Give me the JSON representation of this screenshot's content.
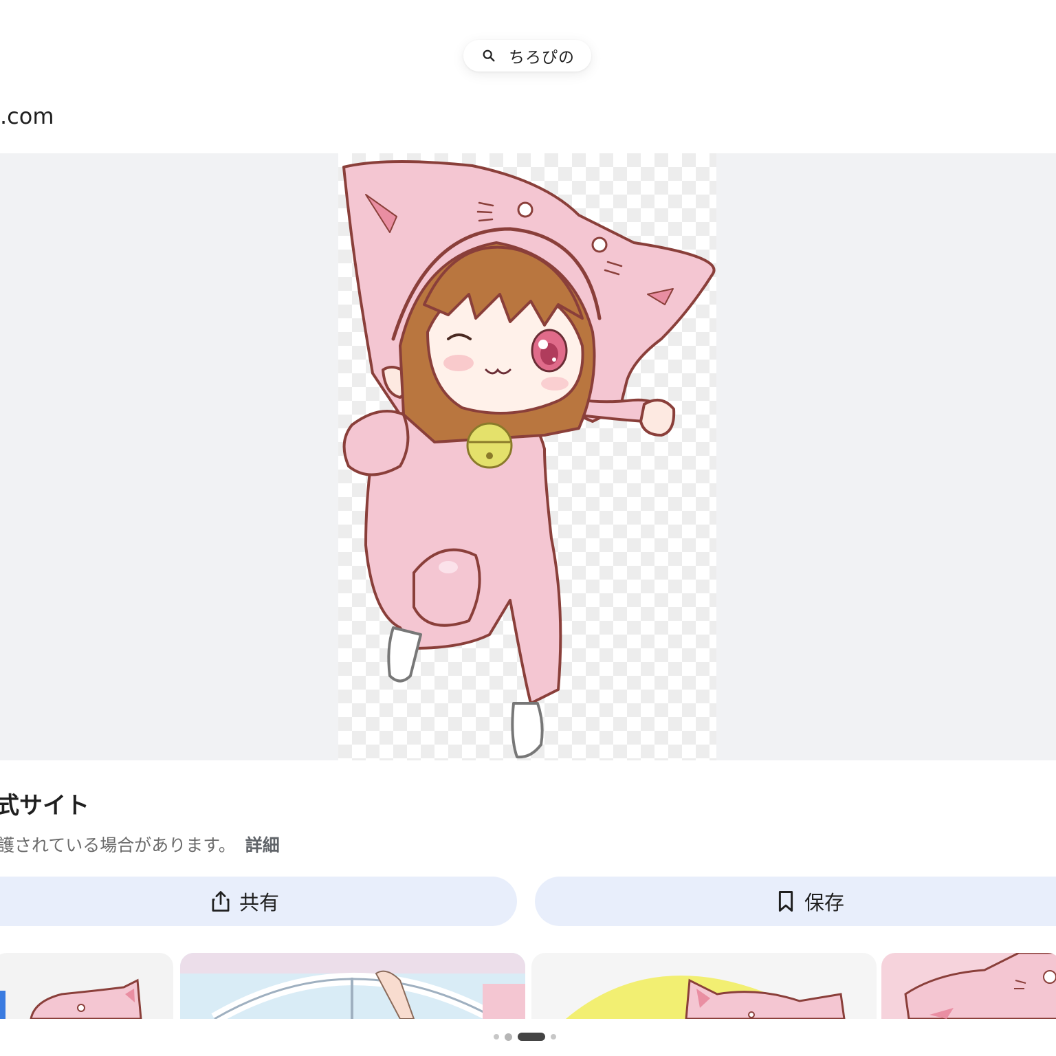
{
  "search": {
    "query": "ちろぴの"
  },
  "result": {
    "domain_fragment": ".com",
    "site_title_fragment": "式サイト",
    "notice_fragment": "護されている場合があります。",
    "details_link": "詳細"
  },
  "actions": {
    "share_label": "共有",
    "save_label": "保存"
  },
  "pager": {
    "count": 4,
    "active_index": 2
  },
  "colors": {
    "accent_button_bg": "#e8eefb",
    "viewer_bg": "#f1f2f4",
    "hood_pink": "#f4c6d2",
    "outline": "#8a3f3a"
  }
}
